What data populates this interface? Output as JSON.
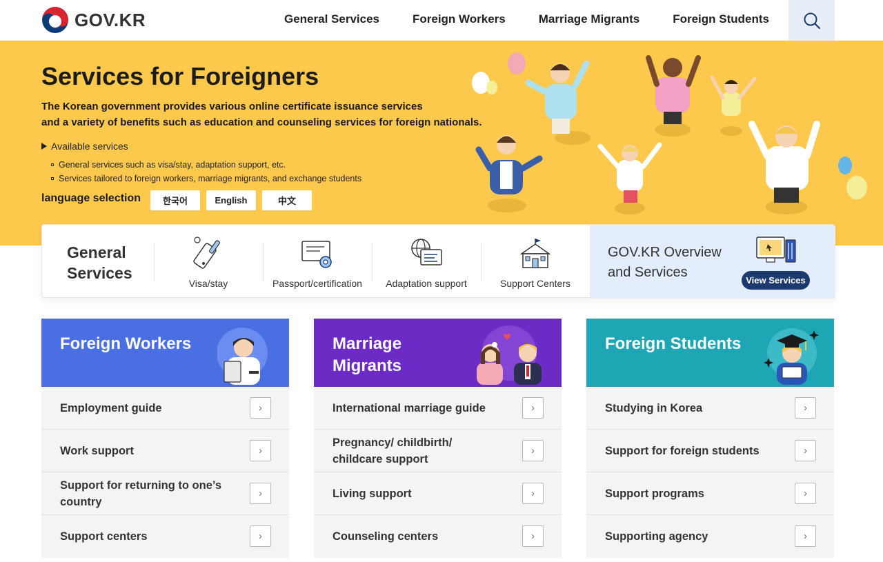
{
  "header": {
    "logo_text": "GOV.KR",
    "nav": [
      "General Services",
      "Foreign Workers",
      "Marriage Migrants",
      "Foreign Students"
    ],
    "search_icon": "search-icon"
  },
  "hero": {
    "title": "Services for Foreigners",
    "desc_line1": "The Korean government provides various online certificate issuance services",
    "desc_line2": "and a variety of benefits such as education and counseling services for foreign nationals.",
    "available_label": "Available services",
    "sub_items": [
      "General services such as visa/stay, adaptation support, etc.",
      "Services tailored to foreign workers, marriage migrants, and exchange students"
    ],
    "language_label": "language selection",
    "languages": [
      "한국어",
      "English",
      "中文"
    ]
  },
  "general_services": {
    "title_line1": "General",
    "title_line2": "Services",
    "items": [
      "Visa/stay",
      "Passport/certification",
      "Adaptation support",
      "Support Centers"
    ],
    "overview_line1": "GOV.KR Overview",
    "overview_line2": "and Services",
    "view_button": "View Services"
  },
  "cards": [
    {
      "title": "Foreign Workers",
      "color": "#4a6fe3",
      "items": [
        "Employment guide",
        "Work support",
        "Support for returning to one’s country",
        "Support centers"
      ]
    },
    {
      "title": "Marriage Migrants",
      "color": "#6b2bc4",
      "items": [
        "International marriage guide",
        "Pregnancy/ childbirth/ childcare support",
        "Living support",
        "Counseling centers"
      ]
    },
    {
      "title": "Foreign Students",
      "color": "#1ea6b4",
      "items": [
        "Studying in Korea",
        "Support for foreign students",
        "Support programs",
        "Supporting agency"
      ]
    }
  ],
  "colors": {
    "hero_bg": "#fcc94d",
    "accent_navy": "#1d3a6e",
    "overview_bg": "#e3edfb"
  }
}
